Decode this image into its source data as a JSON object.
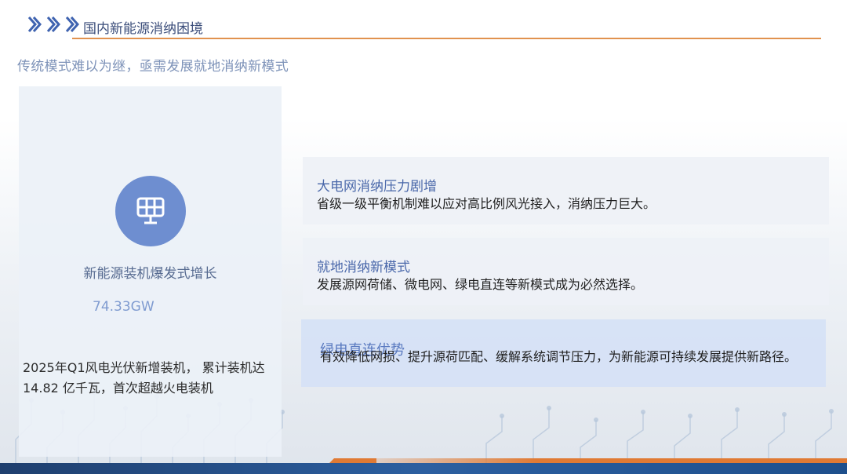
{
  "header": {
    "section_title": "国内新能源消纳困境",
    "subtitle": "传统模式难以为继，亟需发展就地消纳新模式"
  },
  "left_panel": {
    "icon": "solar-panel-icon",
    "title": "新能源装机爆发式增长",
    "number": "74.33GW",
    "description": "2025年Q1风电光伏新增装机，  累计装机达14.82 亿千瓦，首次超越火电装机"
  },
  "cards": [
    {
      "title": "大电网消纳压力剧增",
      "body": "省级一级平衡机制难以应对高比例风光接入，消纳压力巨大。"
    },
    {
      "title": "就地消纳新模式",
      "body": "发展源网荷储、微电网、绿电直连等新模式成为必然选择。"
    },
    {
      "title": "绿电直连优势",
      "body": "有效降低网损、提升源荷匹配、缓解系统调节压力，为新能源可持续发展提供新路径。"
    }
  ],
  "colors": {
    "accent_orange": "#e1924f",
    "title_blue": "#3b4d7a",
    "icon_blue": "#6e8ed0",
    "card_highlight": "#d6e2f6"
  }
}
